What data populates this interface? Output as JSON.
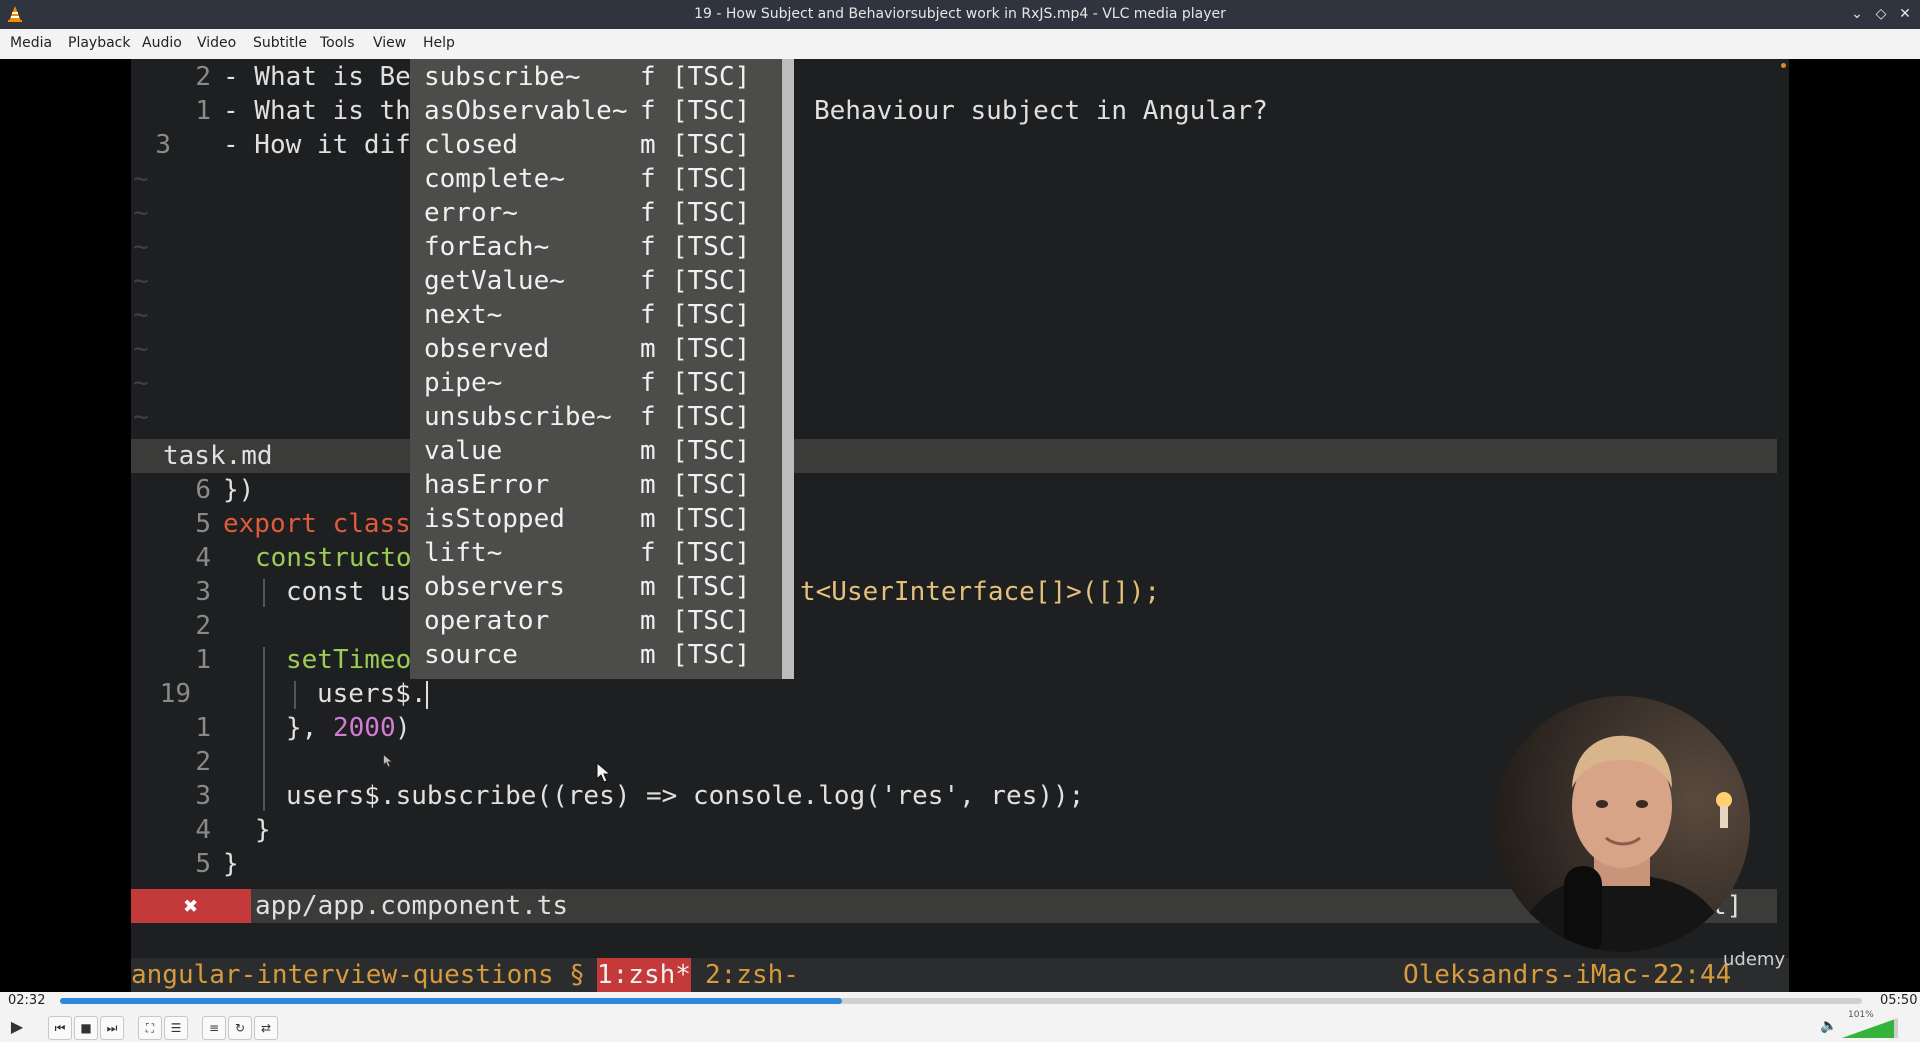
{
  "window": {
    "title": "19 - How Subject and Behaviorsubject work in RxJS.mp4 - VLC media player"
  },
  "menu": [
    "Media",
    "Playback",
    "Audio",
    "Video",
    "Subtitle",
    "Tools",
    "View",
    "Help"
  ],
  "editor": {
    "top_lines": [
      {
        "num": "2",
        "text": "- What is Be"
      },
      {
        "num": "1",
        "text": "- What is th"
      },
      {
        "num": "3",
        "text": "- How it dif"
      }
    ],
    "right_text": "Behaviour subject in Angular?",
    "task_file": "task.md",
    "code_lines": [
      {
        "num": "6",
        "text": "})"
      },
      {
        "num": "5",
        "kw": "export class",
        "text": ""
      },
      {
        "num": "4",
        "fn": "constructo",
        "text": ""
      },
      {
        "num": "3",
        "text": "const us",
        "tail": "t<UserInterface[]>([]);"
      },
      {
        "num": "2",
        "text": ""
      },
      {
        "num": "1",
        "fn": "setTimeo",
        "text": ""
      },
      {
        "num": "19",
        "text": "users$."
      },
      {
        "num": "1",
        "text": "}, ",
        "numtext": "2000",
        "close": ")"
      },
      {
        "num": "2",
        "text": ""
      },
      {
        "num": "3",
        "text": "users$.subscribe((res) => console.log('res', res));"
      },
      {
        "num": "4",
        "text": "}"
      },
      {
        "num": "5",
        "text": "}"
      }
    ],
    "app_file": "app/app.component.ts",
    "app_file_mark": "✖",
    "right_status_tail": "t]",
    "tmux": {
      "session": "angular-interview-questions §",
      "win1": "1:zsh*",
      "win2": "2:zsh-",
      "host": "Oleksandrs-iMac-2",
      "clock": "22:44"
    }
  },
  "autocomplete": [
    {
      "name": "subscribe~",
      "kind": "f",
      "src": "[TSC]"
    },
    {
      "name": "asObservable~",
      "kind": "f",
      "src": "[TSC]"
    },
    {
      "name": "closed",
      "kind": "m",
      "src": "[TSC]"
    },
    {
      "name": "complete~",
      "kind": "f",
      "src": "[TSC]"
    },
    {
      "name": "error~",
      "kind": "f",
      "src": "[TSC]"
    },
    {
      "name": "forEach~",
      "kind": "f",
      "src": "[TSC]"
    },
    {
      "name": "getValue~",
      "kind": "f",
      "src": "[TSC]"
    },
    {
      "name": "next~",
      "kind": "f",
      "src": "[TSC]"
    },
    {
      "name": "observed",
      "kind": "m",
      "src": "[TSC]"
    },
    {
      "name": "pipe~",
      "kind": "f",
      "src": "[TSC]"
    },
    {
      "name": "unsubscribe~",
      "kind": "f",
      "src": "[TSC]"
    },
    {
      "name": "value",
      "kind": "m",
      "src": "[TSC]"
    },
    {
      "name": "hasError",
      "kind": "m",
      "src": "[TSC]"
    },
    {
      "name": "isStopped",
      "kind": "m",
      "src": "[TSC]"
    },
    {
      "name": "lift~",
      "kind": "f",
      "src": "[TSC]"
    },
    {
      "name": "observers",
      "kind": "m",
      "src": "[TSC]"
    },
    {
      "name": "operator",
      "kind": "m",
      "src": "[TSC]"
    },
    {
      "name": "source",
      "kind": "m",
      "src": "[TSC]"
    }
  ],
  "watermark": "udemy",
  "player": {
    "elapsed": "02:32",
    "total": "05:50",
    "progress": 0.434,
    "volume_label": "101%"
  }
}
